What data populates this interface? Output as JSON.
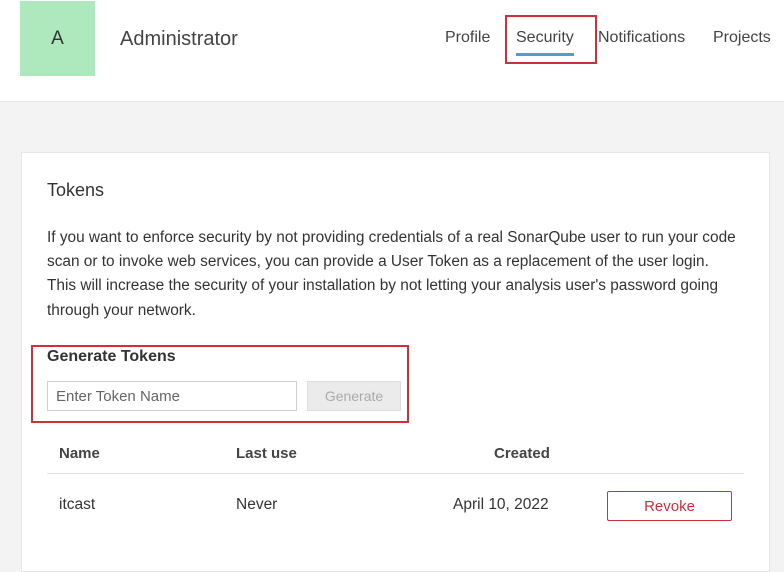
{
  "user": {
    "avatar_initial": "A",
    "name": "Administrator"
  },
  "nav": {
    "tabs": [
      {
        "label": "Profile",
        "active": false
      },
      {
        "label": "Security",
        "active": true
      },
      {
        "label": "Notifications",
        "active": false
      },
      {
        "label": "Projects",
        "active": false
      }
    ]
  },
  "tokens": {
    "title": "Tokens",
    "description": "If you want to enforce security by not providing credentials of a real SonarQube user to run your code scan or to invoke web services, you can provide a User Token as a replacement of the user login. This will increase the security of your installation by not letting your analysis user's password going through your network.",
    "generate": {
      "title": "Generate Tokens",
      "input_placeholder": "Enter Token Name",
      "input_value": "",
      "button_label": "Generate"
    },
    "table": {
      "headers": {
        "name": "Name",
        "last_use": "Last use",
        "created": "Created"
      },
      "rows": [
        {
          "name": "itcast",
          "last_use": "Never",
          "created": "April 10, 2022",
          "action_label": "Revoke"
        }
      ]
    }
  },
  "colors": {
    "avatar_bg": "#aee9bd",
    "active_tab_underline": "#4b9fd5",
    "annotation_red": "#d02f3a",
    "revoke_red": "#d02f3a"
  }
}
